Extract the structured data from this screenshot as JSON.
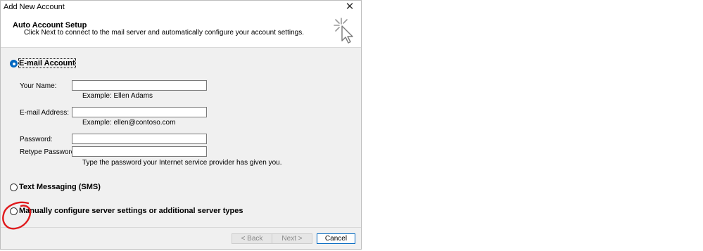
{
  "window": {
    "title": "Add New Account",
    "close_glyph": "✕"
  },
  "header": {
    "title": "Auto Account Setup",
    "description": "Click Next to connect to the mail server and automatically configure your account settings.",
    "icon": "wizard-cursor-icon"
  },
  "options": {
    "email_account": {
      "label": "E-mail Account",
      "selected": true
    },
    "text_messaging": {
      "label": "Text Messaging (SMS)",
      "selected": false
    },
    "manual": {
      "label": "Manually configure server settings or additional server types",
      "selected": false
    }
  },
  "form": {
    "your_name": {
      "label": "Your Name:",
      "value": "",
      "hint": "Example: Ellen Adams"
    },
    "email_address": {
      "label": "E-mail Address:",
      "value": "",
      "hint": "Example: ellen@contoso.com"
    },
    "password": {
      "label": "Password:",
      "value": ""
    },
    "retype_password": {
      "label": "Retype Password:",
      "value": ""
    },
    "password_hint": "Type the password your Internet service provider has given you."
  },
  "buttons": {
    "back": "< Back",
    "next": "Next >",
    "cancel": "Cancel"
  },
  "annotation": {
    "color": "#e0191c"
  },
  "colors": {
    "accent": "#0067c0",
    "dialog_bg": "#f0f0f0",
    "header_bg": "#ffffff"
  }
}
